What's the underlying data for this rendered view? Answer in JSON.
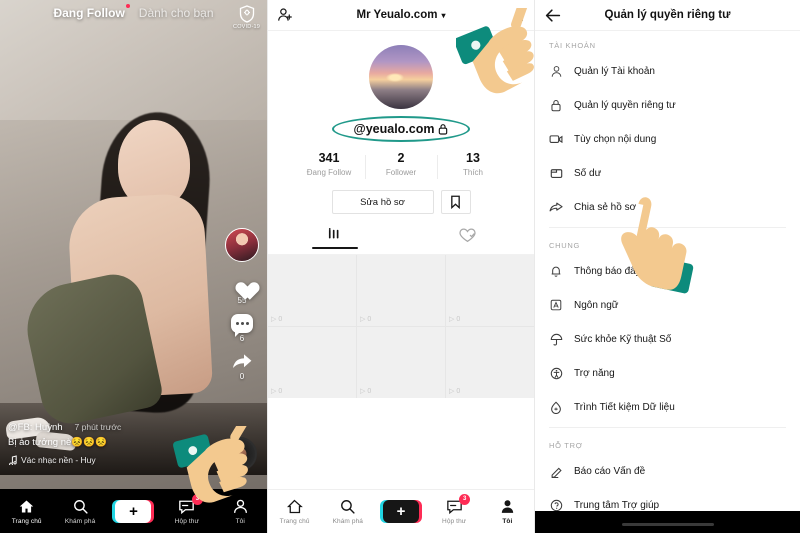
{
  "colors": {
    "accent_pink": "#fe2c55",
    "accent_cyan": "#20d5e3",
    "annotation_green": "#20998a",
    "hand_skin": "#f3c98f",
    "hand_sleeve": "#0d8b7c"
  },
  "left_panel": {
    "name": "tiktok-video-feed",
    "top_tabs": {
      "following": "Đang Follow",
      "for_you": "Dành cho bạn"
    },
    "covid_badge": "COVID-19",
    "side_actions": [
      {
        "icon": "heart-icon",
        "count": "55"
      },
      {
        "icon": "comment-icon",
        "count": "6"
      },
      {
        "icon": "share-icon",
        "count": "0"
      }
    ],
    "caption": {
      "author": "@FB: Huỳnh",
      "time": "7 phút trước",
      "text": "Bị ảo tưởng nè😣😣😣",
      "music": "Vác  nhạc nền - Huy"
    },
    "bottom_nav": [
      {
        "label": "Trang chủ",
        "icon": "home-icon",
        "active": true
      },
      {
        "label": "Khám phá",
        "icon": "search-icon",
        "active": false
      },
      {
        "label": "",
        "icon": "plus-icon",
        "active": false
      },
      {
        "label": "Hộp thư",
        "icon": "inbox-icon",
        "badge": "3",
        "active": false
      },
      {
        "label": "Tôi",
        "icon": "profile-icon",
        "active": false
      }
    ]
  },
  "mid_panel": {
    "name": "tiktok-profile",
    "header": {
      "add_friend_icon": "add-friend-icon",
      "title": "Mr Yeualo.com",
      "chevron": "▾",
      "more_icon": "more-options-icon"
    },
    "avatar": "profile-avatar",
    "handle": "@yeualo.com",
    "handle_lock_icon": "lock-icon",
    "stats": [
      {
        "num": "341",
        "label": "Đang Follow"
      },
      {
        "num": "2",
        "label": "Follower"
      },
      {
        "num": "13",
        "label": "Thích"
      }
    ],
    "edit_button": "Sửa hồ sơ",
    "bookmark_icon": "bookmark-icon",
    "tabs": [
      {
        "icon": "grid-icon",
        "active": true
      },
      {
        "icon": "liked-heart-icon",
        "active": false
      }
    ],
    "grid_cells": [
      {
        "plays": "0"
      },
      {
        "plays": "0"
      },
      {
        "plays": "0"
      },
      {
        "plays": "0"
      },
      {
        "plays": "0"
      },
      {
        "plays": "0"
      }
    ],
    "bottom_nav": [
      {
        "label": "Trang chủ",
        "icon": "home-icon",
        "active": false
      },
      {
        "label": "Khám phá",
        "icon": "search-icon",
        "active": false
      },
      {
        "label": "",
        "icon": "plus-icon",
        "active": false
      },
      {
        "label": "Hộp thư",
        "icon": "inbox-icon",
        "badge": "3",
        "active": false
      },
      {
        "label": "Tôi",
        "icon": "profile-icon",
        "active": true
      }
    ]
  },
  "right_panel": {
    "name": "privacy-settings",
    "back_icon": "back-arrow-icon",
    "title": "Quản lý quyền riêng tư",
    "sections": [
      {
        "heading": "TÀI KHOẢN",
        "items": [
          {
            "icon": "person-icon",
            "label": "Quản lý Tài khoản"
          },
          {
            "icon": "lock-icon",
            "label": "Quản lý quyền riêng tư"
          },
          {
            "icon": "video-icon",
            "label": "Tùy chọn nội dung"
          },
          {
            "icon": "wallet-icon",
            "label": "Số dư"
          },
          {
            "icon": "share-arrow-icon",
            "label": "Chia sẻ hồ sơ"
          }
        ]
      },
      {
        "heading": "CHUNG",
        "items": [
          {
            "icon": "bell-icon",
            "label": "Thông báo đẩy"
          },
          {
            "icon": "language-icon",
            "label": "Ngôn ngữ"
          },
          {
            "icon": "umbrella-icon",
            "label": "Sức khỏe Kỹ thuật Số"
          },
          {
            "icon": "accessibility-icon",
            "label": "Trợ năng"
          },
          {
            "icon": "data-saver-icon",
            "label": "Trình Tiết kiệm Dữ liệu"
          }
        ]
      },
      {
        "heading": "HỖ TRỢ",
        "items": [
          {
            "icon": "pencil-icon",
            "label": "Báo cáo Vấn đề"
          },
          {
            "icon": "question-icon",
            "label": "Trung tâm Trợ giúp"
          }
        ]
      }
    ]
  },
  "cursors": [
    {
      "name": "hand-cursor-profile-tab",
      "target": "Tôi"
    },
    {
      "name": "hand-cursor-more-options",
      "target": "more-options-icon"
    },
    {
      "name": "hand-cursor-share-profile",
      "target": "Chia sẻ hồ sơ"
    }
  ]
}
